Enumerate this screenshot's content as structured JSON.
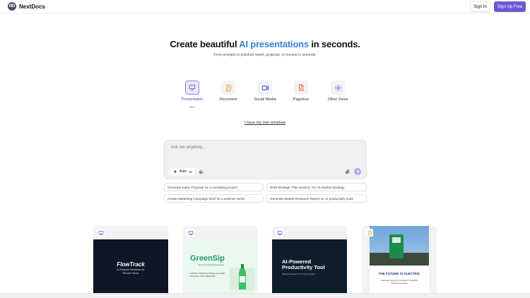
{
  "header": {
    "logo_mark": "ND",
    "logo_text": "NextDocs",
    "signin_label": "Sign In",
    "signup_label": "Sign Up Free"
  },
  "hero": {
    "title_before": "Create beautiful ",
    "title_accent": "AI presentations",
    "title_after": " in seconds.",
    "subtitle": "From prompts to polished report, proposal, or resume in seconds."
  },
  "types": [
    {
      "label": "Presentation",
      "sub": "16:9",
      "icon": "monitor-icon",
      "active": true
    },
    {
      "label": "Document",
      "icon": "document-icon",
      "active": false
    },
    {
      "label": "Social Media",
      "icon": "video-camera-icon",
      "active": false
    },
    {
      "label": "Pageless",
      "icon": "file-icon",
      "active": false
    },
    {
      "label": "Other Sizes",
      "icon": "gear-icon",
      "active": false
    }
  ],
  "own_template": "I have my own template",
  "prompt": {
    "placeholder": "Ask me anything...",
    "auto_label": "Auto"
  },
  "suggestions": [
    "Generate Sales Proposal for a consulting project",
    "Draft Strategic Plan Section: Go-To-Market Strategy",
    "Create Marketing Campaign Brief for a webinar series",
    "Generate Market Research Report on AI productivity tools"
  ],
  "templates": [
    {
      "title": "FlowTrack",
      "text": "AI-Powered Workflows for Remote Teams"
    },
    {
      "title": "GreenSip",
      "subtitle": "Eco-Friendly Sparkling Water",
      "text": "A Modern Marketing Strategy for Health-Conscious Urban Millennials"
    },
    {
      "title": "AI-Powered Productivity Tool",
      "text": "Market Research Summary Report"
    },
    {
      "title": "THE FUTURE IS ELECTRIC",
      "text": "A Research Report on the Adoption of Electric Vehicles in Australia"
    }
  ],
  "colors": {
    "accent": "#3e7ee0",
    "primary_button": "#6c58d4"
  }
}
